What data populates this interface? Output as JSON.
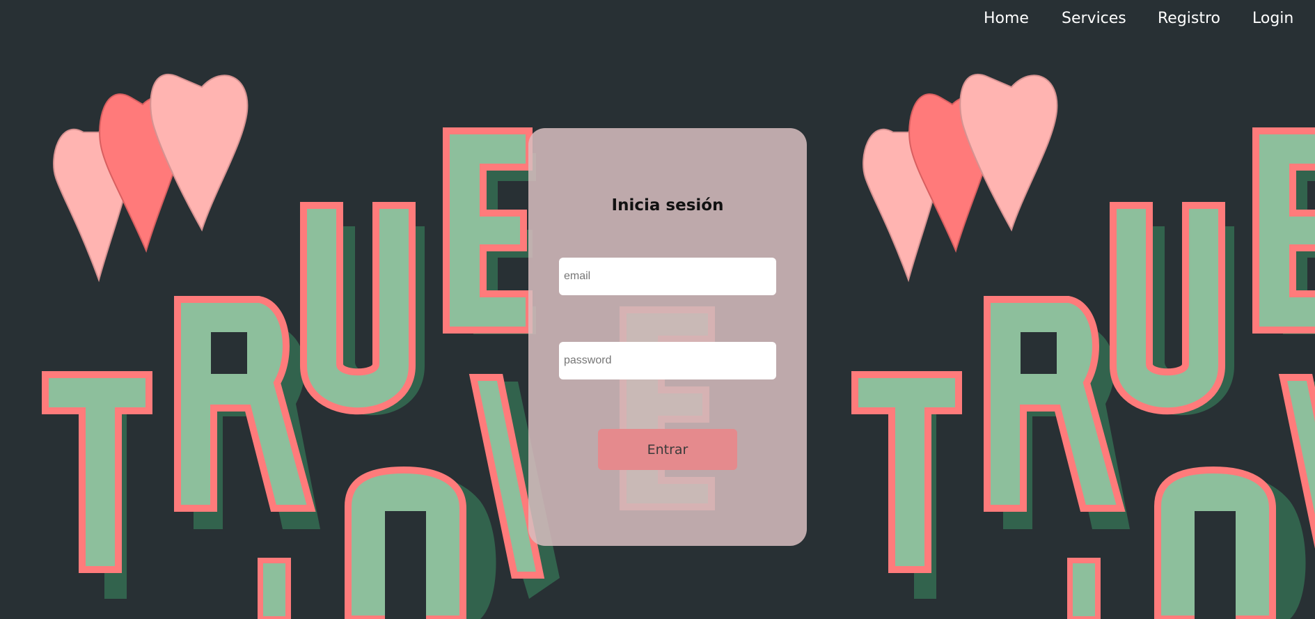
{
  "nav": {
    "items": [
      {
        "label": "Home"
      },
      {
        "label": "Services"
      },
      {
        "label": "Registro"
      },
      {
        "label": "Login"
      }
    ]
  },
  "login": {
    "title": "Inicia sesión",
    "email_placeholder": "email",
    "password_placeholder": "password",
    "submit_label": "Entrar"
  },
  "colors": {
    "background": "#283034",
    "letter_fill": "#8DBF9C",
    "letter_outline": "#FF7B7B",
    "letter_shadow": "#33664F",
    "heart_light": "#FFB4B1",
    "heart_dark": "#FF7A7A",
    "card": "#D7BEBF",
    "button": "#E58A8D"
  },
  "background_art": {
    "description_icon": "true-love-typography-with-hearts"
  }
}
